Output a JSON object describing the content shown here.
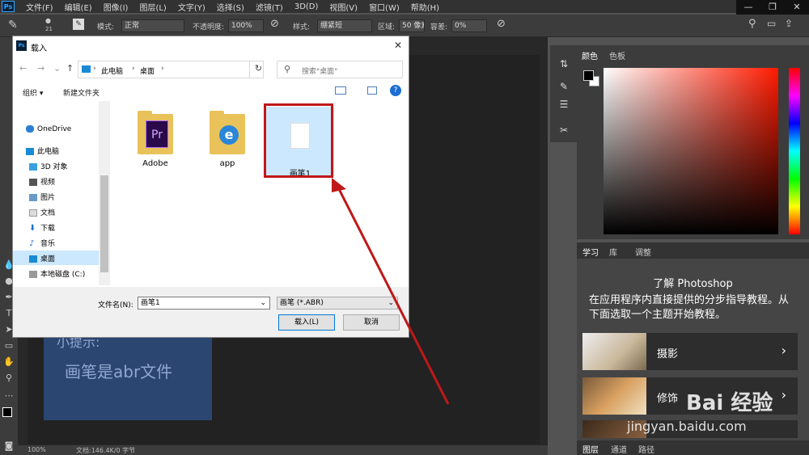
{
  "menubar": {
    "logo": "Ps",
    "items": [
      "文件(F)",
      "编辑(E)",
      "图像(I)",
      "图层(L)",
      "文字(Y)",
      "选择(S)",
      "滤镜(T)",
      "3D(D)",
      "视图(V)",
      "窗口(W)",
      "帮助(H)"
    ]
  },
  "window_controls": {
    "minimize": "—",
    "restore": "❐",
    "close": "✕"
  },
  "options": {
    "brush_size": "21",
    "mode_label": "模式:",
    "mode_value": "正常",
    "opacity_label": "不透明度:",
    "opacity_value": "100%",
    "style_label": "样式:",
    "style_value": "绷紧短",
    "area_label": "区域:",
    "area_value": "50 像素",
    "tolerance_label": "容差:",
    "tolerance_value": "0%"
  },
  "canvas": {
    "tip_title": "小提示:",
    "tip_text": "画笔是abr文件"
  },
  "status": {
    "zoom": "100%",
    "doc": "文档:146.4K/0 字节"
  },
  "color_panel": {
    "tab1": "颜色",
    "tab2": "色板"
  },
  "learn_panel": {
    "tabs": [
      "学习",
      "库",
      "调整"
    ],
    "title": "了解 Photoshop",
    "desc": "在应用程序内直接提供的分步指导教程。从下面选取一个主题开始教程。",
    "cards": [
      {
        "label": "摄影"
      },
      {
        "label": "修饰"
      }
    ]
  },
  "layers_tabs": [
    "图层",
    "通道",
    "路径"
  ],
  "dialog": {
    "title": "载入",
    "close": "✕",
    "breadcrumb": [
      "此电脑",
      "桌面"
    ],
    "search_placeholder": "搜索\"桌面\"",
    "organize": "组织 ▾",
    "new_folder": "新建文件夹",
    "nav": [
      "OneDrive",
      "此电脑",
      "3D 对象",
      "视频",
      "图片",
      "文档",
      "下载",
      "音乐",
      "桌面",
      "本地磁盘 (C:)"
    ],
    "files": [
      {
        "name": "Adobe"
      },
      {
        "name": "app"
      },
      {
        "name": "画笔1"
      }
    ],
    "filename_label": "文件名(N):",
    "filename_value": "画笔1",
    "filetype_value": "画笔 (*.ABR)",
    "load_button": "载入(L)",
    "cancel_button": "取消"
  },
  "watermark": {
    "brand": "Bai 经验",
    "url": "jingyan.baidu.com"
  },
  "colors": {
    "accent_red": "#c01818",
    "selection_blue": "#cce8ff",
    "ps_blue": "#31a8ff"
  }
}
